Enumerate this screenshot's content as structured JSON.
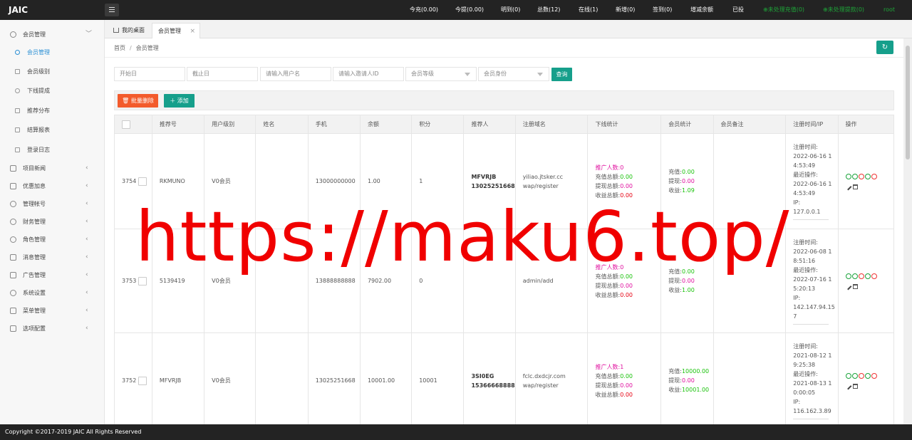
{
  "app": {
    "logo": "JAIC"
  },
  "header": {
    "stats": [
      {
        "label": "今充(0.00)"
      },
      {
        "label": "今提(0.00)"
      },
      {
        "label": "明到(0)"
      },
      {
        "label": "总数(12)"
      },
      {
        "label": "在线(1)"
      },
      {
        "label": "新增(0)"
      },
      {
        "label": "签到(0)"
      },
      {
        "label": "增减余额"
      },
      {
        "label": "已投"
      }
    ],
    "alerts": [
      {
        "label": "⊕未处理充值(0)"
      },
      {
        "label": "⊕未处理提款(0)"
      }
    ],
    "user": "root"
  },
  "sidebar": {
    "group_member": "会员管理",
    "sub_items": [
      {
        "label": "会员管理"
      },
      {
        "label": "会员级别"
      },
      {
        "label": "下线提成"
      },
      {
        "label": "推荐分布"
      },
      {
        "label": "结算报表"
      },
      {
        "label": "登录日志"
      }
    ],
    "groups": [
      {
        "label": "项目新闻"
      },
      {
        "label": "优惠加息"
      },
      {
        "label": "管理帐号"
      },
      {
        "label": "财务管理"
      },
      {
        "label": "角色管理"
      },
      {
        "label": "消息管理"
      },
      {
        "label": "广告管理"
      },
      {
        "label": "系统设置"
      },
      {
        "label": "菜单管理"
      },
      {
        "label": "选项配置"
      }
    ]
  },
  "tabs": {
    "home": "我的桌面",
    "current": "会员管理",
    "close": "×"
  },
  "breadcrumb": {
    "home": "首页",
    "sep": "/",
    "current": "会员管理"
  },
  "filters": {
    "start_date": "开始日",
    "end_date": "截止日",
    "username": "请输入用户名",
    "inviter_id": "请输入邀请人ID",
    "level": "会员等级",
    "identity": "会员身份",
    "search": "查询"
  },
  "actions": {
    "batch_delete": "批量删除",
    "add": "添加"
  },
  "table": {
    "headers": [
      "",
      "推荐号",
      "用户级别",
      "姓名",
      "手机",
      "余额",
      "积分",
      "推荐人",
      "注册域名",
      "下线统计",
      "会员统计",
      "会员备注",
      "注册时间/IP",
      "操作"
    ],
    "labels": {
      "promo": "推广人数:",
      "recharge_total": "充值总额:",
      "withdraw_total": "提现总额:",
      "income_total": "收益总额:",
      "recharge": "充值:",
      "withdraw": "提现:",
      "income": "收益:"
    },
    "rows": [
      {
        "id": "3754",
        "ref_code": "RKMUNO",
        "level": "V0会员",
        "name": "",
        "phone": "13000000000",
        "balance": "1.00",
        "points": "1",
        "referrer_code": "MFVRJB",
        "referrer_phone": "13025251668",
        "domain": "yiliao.jtsker.cc",
        "path": "wap/register",
        "promo": "0",
        "recharge_total": "0.00",
        "withdraw_total": "0.00",
        "income_total": "0.00",
        "recharge": "0.00",
        "withdraw": "0.00",
        "income": "1.09",
        "reg_time_label": "注册时间:",
        "reg_time_a": "2022-06-16 1",
        "reg_time_b": "4:53:49",
        "last_label": "最近操作:",
        "last_a": "2022-06-16 1",
        "last_b": "4:53:49",
        "ip_label": "IP:",
        "ip_a": "127.0.0.1",
        "ip_b": ""
      },
      {
        "id": "3753",
        "ref_code": "5139419",
        "level": "V0会员",
        "name": "",
        "phone": "13888888888",
        "balance": "7902.00",
        "points": "0",
        "referrer_code": "",
        "referrer_phone": "",
        "domain": "",
        "path": "admin/add",
        "promo": "0",
        "recharge_total": "0.00",
        "withdraw_total": "0.00",
        "income_total": "0.00",
        "recharge": "0.00",
        "withdraw": "0.00",
        "income": "1.00",
        "reg_time_label": "注册时间:",
        "reg_time_a": "2022-06-08 1",
        "reg_time_b": "8:51:16",
        "last_label": "最近操作:",
        "last_a": "2022-07-16 1",
        "last_b": "5:20:13",
        "ip_label": "IP:",
        "ip_a": "142.147.94.15",
        "ip_b": "7"
      },
      {
        "id": "3752",
        "ref_code": "MFVRJB",
        "level": "V0会员",
        "name": "",
        "phone": "13025251668",
        "balance": "10001.00",
        "points": "10001",
        "referrer_code": "3SI0EG",
        "referrer_phone": "15366668888",
        "domain": "fclc.dxdcjr.com",
        "path": "wap/register",
        "promo": "1",
        "recharge_total": "0.00",
        "withdraw_total": "0.00",
        "income_total": "0.00",
        "recharge": "10000.00",
        "withdraw": "0.00",
        "income": "10001.00",
        "reg_time_label": "注册时间:",
        "reg_time_a": "2021-08-12 1",
        "reg_time_b": "9:25:38",
        "last_label": "最近操作:",
        "last_a": "2021-08-13 1",
        "last_b": "0:00:05",
        "ip_label": "IP:",
        "ip_a": "116.162.3.89",
        "ip_b": ""
      }
    ]
  },
  "footer": "Copyright ©2017-2019 JAIC All Rights Reserved",
  "watermark": "https://maku6.top/",
  "colors": {
    "header_bg": "#232323",
    "primary": "#169f8b",
    "danger": "#f35b2c",
    "watermark": "#f00000"
  }
}
